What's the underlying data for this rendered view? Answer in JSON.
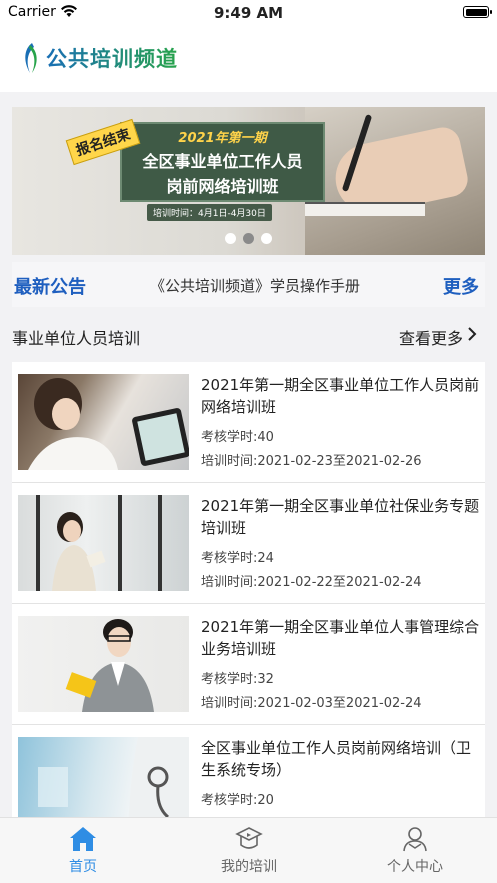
{
  "status_bar": {
    "carrier": "Carrier",
    "time": "9:49 AM"
  },
  "header": {
    "logo_text": "公共培训频道"
  },
  "banner": {
    "ribbon": "报名结束",
    "subtitle": "2021年第一期",
    "line1": "全区事业单位工作人员",
    "line2": "岗前网络培训班",
    "dates": "培训时间：4月1日-4月30日",
    "active_dot": 1
  },
  "notice": {
    "label": "最新公告",
    "text": "《公共培训频道》学员操作手册",
    "more": "更多"
  },
  "section": {
    "title": "事业单位人员培训",
    "view_more": "查看更多"
  },
  "courses": [
    {
      "title": "2021年第一期全区事业单位工作人员岗前网络培训班",
      "hours": "考核学时:40",
      "period": "培训时间:2021-02-23至2021-02-26"
    },
    {
      "title": "2021年第一期全区事业单位社保业务专题培训班",
      "hours": "考核学时:24",
      "period": "培训时间:2021-02-22至2021-02-24"
    },
    {
      "title": "2021年第一期全区事业单位人事管理综合业务培训班",
      "hours": "考核学时:32",
      "period": "培训时间:2021-02-03至2021-02-24"
    },
    {
      "title": "全区事业单位工作人员岗前网络培训（卫生系统专场）",
      "hours": "考核学时:20",
      "period": ""
    }
  ],
  "tabs": [
    {
      "label": "首页",
      "icon": "home-icon",
      "active": true
    },
    {
      "label": "我的培训",
      "icon": "graduation-cap-icon",
      "active": false
    },
    {
      "label": "个人中心",
      "icon": "user-icon",
      "active": false
    }
  ],
  "colors": {
    "accent": "#2f8de4",
    "link": "#1f5fbf",
    "board": "#3f5a46",
    "ribbon": "#ffd64a"
  }
}
